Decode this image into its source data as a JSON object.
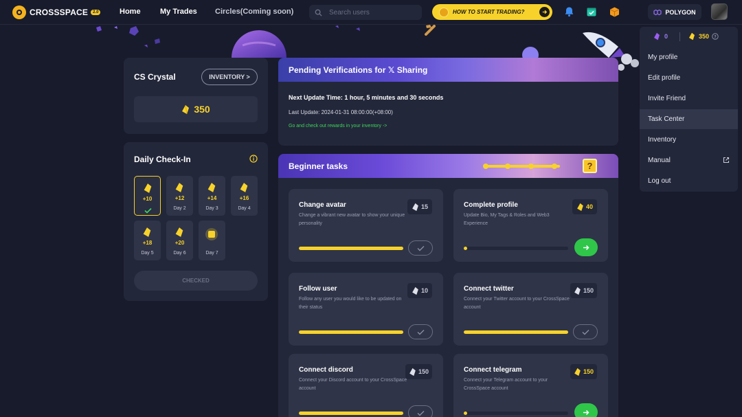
{
  "nav": {
    "logo_text": "CROSSSPACE",
    "logo_badge": "2.0",
    "home": "Home",
    "my_trades": "My Trades",
    "circles": "Circles(Coming soon)",
    "search_placeholder": "Search users",
    "trade_button": "HOW TO START TRADING?",
    "network": "POLYGON"
  },
  "crystal": {
    "title": "CS Crystal",
    "inventory_button": "INVENTORY >",
    "amount": "350"
  },
  "checkin": {
    "title": "Daily Check-In",
    "days": [
      {
        "amount": "+10",
        "label": "",
        "checked": true
      },
      {
        "amount": "+12",
        "label": "Day 2"
      },
      {
        "amount": "+14",
        "label": "Day 3"
      },
      {
        "amount": "+16",
        "label": "Day 4"
      },
      {
        "amount": "+18",
        "label": "Day 5"
      },
      {
        "amount": "+20",
        "label": "Day 6"
      },
      {
        "amount": "",
        "label": "Day 7"
      }
    ],
    "button": "CHECKED"
  },
  "pending": {
    "title": "Pending Verifications for 𝕏 Sharing",
    "next_update": "Next Update Time: 1 hour, 5 minutes and 30 seconds",
    "last_update": "Last Update: 2024-01-31 08:00:00(+08:00)",
    "link": "Go and check out rewards in your inventory ->"
  },
  "tasks": {
    "title": "Beginner tasks",
    "items": [
      {
        "title": "Change avatar",
        "desc": "Change a vibrant new avatar to show your unique personality",
        "reward": "15",
        "reward_type": "silver",
        "progress": 1.0,
        "status": "done"
      },
      {
        "title": "Complete profile",
        "desc": "Update Bio, My Tags & Roles and Web3 Experience",
        "reward": "40",
        "reward_type": "gold",
        "progress": 0.0,
        "status": "go"
      },
      {
        "title": "Follow user",
        "desc": "Follow any user you would like to be updated on their status",
        "reward": "10",
        "reward_type": "silver",
        "progress": 1.0,
        "status": "done"
      },
      {
        "title": "Connect twitter",
        "desc": "Connect your Twitter account to your CrossSpace account",
        "reward": "150",
        "reward_type": "silver",
        "progress": 1.0,
        "status": "done"
      },
      {
        "title": "Connect discord",
        "desc": "Connect your Discord account to your CrossSpace account",
        "reward": "150",
        "reward_type": "silver",
        "progress": 1.0,
        "status": "done"
      },
      {
        "title": "Connect telegram",
        "desc": "Connect your Telegram account to your CrossSpace account",
        "reward": "150",
        "reward_type": "gold",
        "progress": 0.0,
        "status": "go"
      }
    ]
  },
  "menu": {
    "purple_balance": "0",
    "gold_balance": "350",
    "items": [
      "My profile",
      "Edit profile",
      "Invite Friend",
      "Task Center",
      "Inventory",
      "Manual",
      "Log out"
    ],
    "active_item": "Task Center"
  },
  "colors": {
    "background": "#181b2b",
    "card": "#23273a",
    "accent_yellow": "#f7d22a",
    "accent_green": "#2fc64a",
    "link_green": "#3fd65d"
  }
}
